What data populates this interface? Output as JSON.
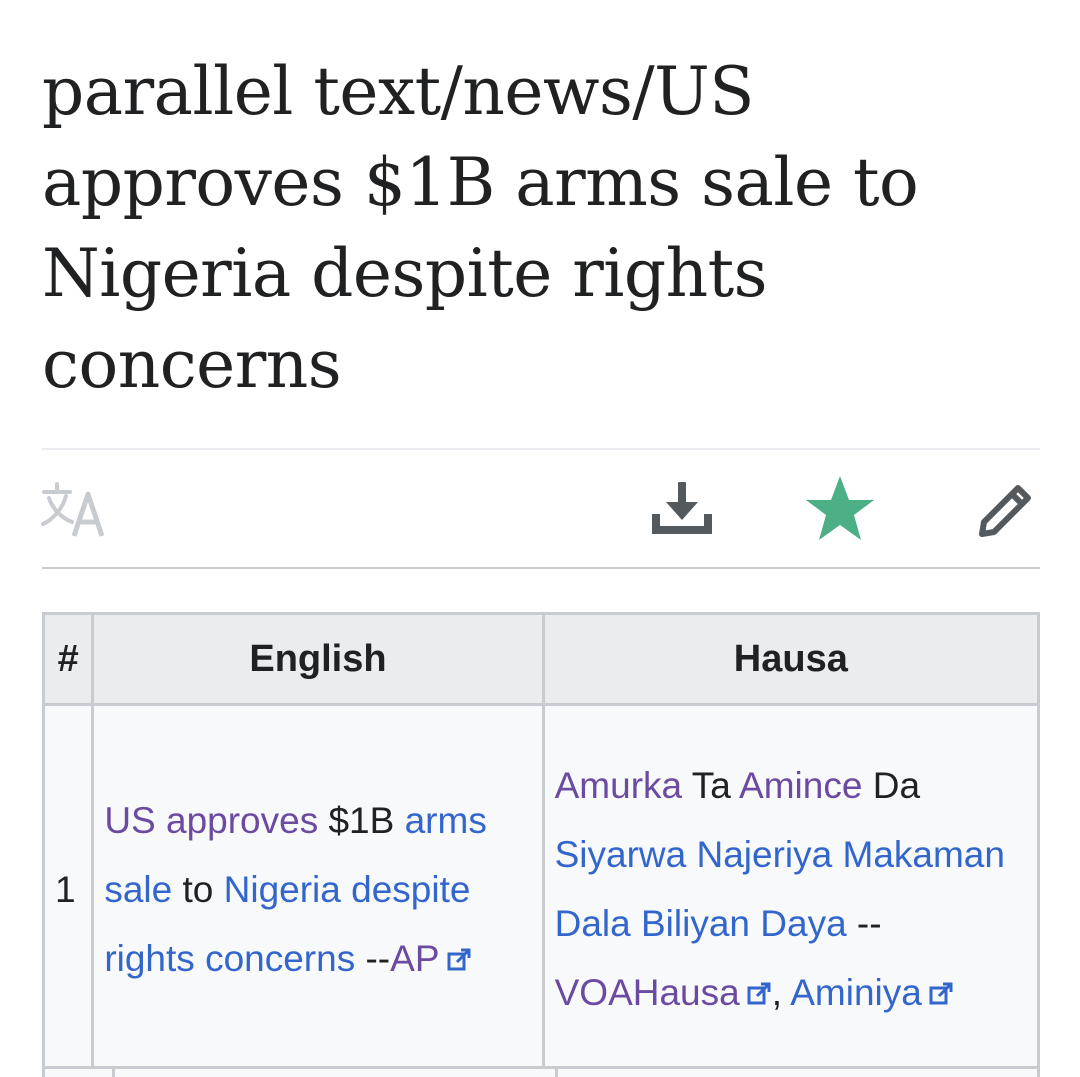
{
  "page": {
    "title": "parallel text/news/US approves $1B arms sale to Nigeria despite rights concerns"
  },
  "toolbar": {
    "language_icon": "translate-icon",
    "download_icon": "download-icon",
    "watch_icon": "star-icon",
    "edit_icon": "pencil-icon",
    "watch_color": "#4caf86"
  },
  "table": {
    "headers": {
      "num": "#",
      "english": "English",
      "hausa": "Hausa"
    },
    "rows": [
      {
        "num": "1",
        "english": {
          "w1": "US approves",
          "t1": " $1B ",
          "w2": "arms sale",
          "t2": " to ",
          "w3": "Nigeria despite rights concerns",
          "t3": " --",
          "source": "AP"
        },
        "hausa": {
          "w1": "Amurka",
          "t1": " Ta ",
          "w2": "Amince",
          "t2": " Da ",
          "w3": "Siyarwa Najeriya Makaman Dala Biliyan Daya",
          "t3": " --",
          "source1": "VOAHausa",
          "sep": ",",
          "source2": "Aminiya"
        }
      }
    ]
  },
  "colors": {
    "link": "#3366cc",
    "visited_link": "#6b4ba1",
    "text": "#202122"
  }
}
